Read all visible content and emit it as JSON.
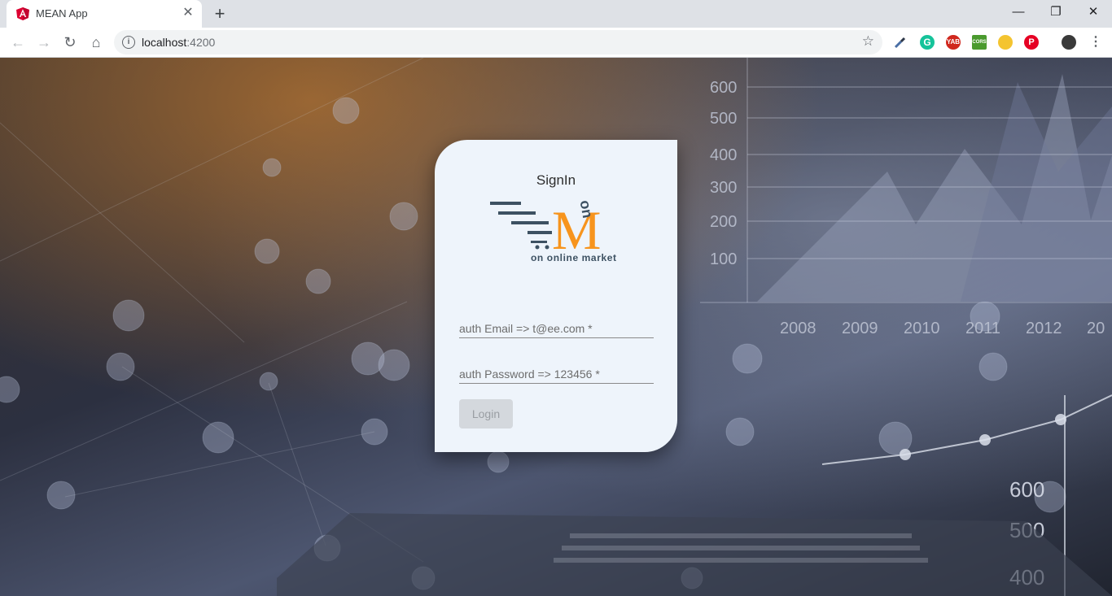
{
  "browser": {
    "tab_title": "MEAN App",
    "url_host": "localhost",
    "url_port": ":4200",
    "icons": [
      "angular-favicon",
      "back-arrow-icon",
      "forward-arrow-icon",
      "reload-icon",
      "home-icon",
      "info-icon",
      "bookmark-star-icon",
      "eyedropper-icon",
      "grammarly-icon",
      "yab-icon",
      "cors-icon",
      "moon-icon",
      "pinterest-icon",
      "avatar",
      "menu-icon"
    ],
    "extensions": {
      "yab": "YAB",
      "cors": "CORS"
    }
  },
  "background_chart": {
    "y_ticks": [
      "600",
      "500",
      "400",
      "300",
      "200",
      "100"
    ],
    "x_ticks": [
      "2008",
      "2009",
      "2010",
      "2011",
      "2012",
      "20"
    ],
    "small_ticks": [
      "600",
      "500",
      "400"
    ]
  },
  "signin": {
    "title": "SignIn",
    "logo_letter": "M",
    "logo_on": "on",
    "logo_tagline": "on online market",
    "email_placeholder": "auth Email => t@ee.com *",
    "password_placeholder": "auth Password => 123456 *",
    "login_label": "Login"
  },
  "colors": {
    "card": "#eef4fb",
    "logo_orange": "#f7941d",
    "logo_navy": "#3d5162",
    "button_disabled": "#d4d8dd"
  }
}
